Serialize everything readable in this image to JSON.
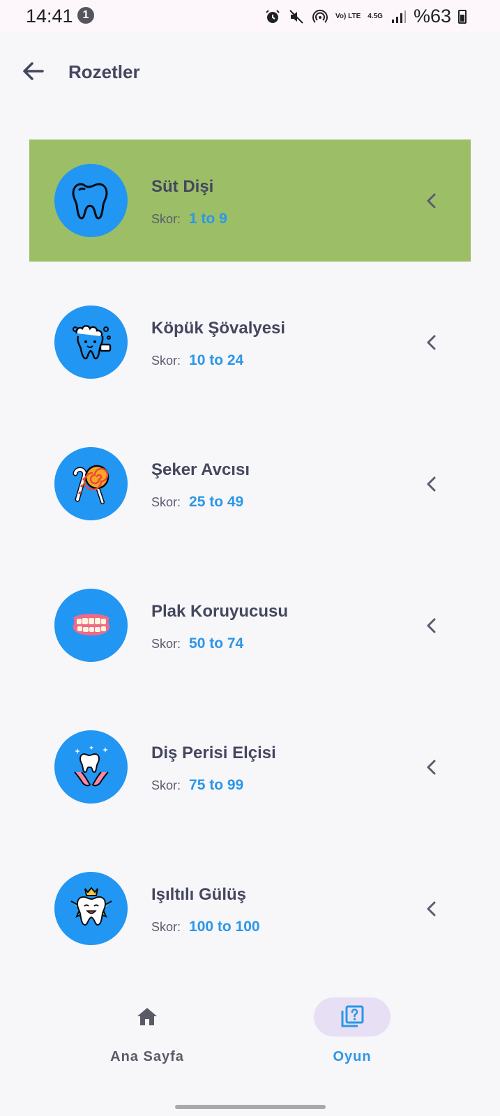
{
  "status_bar": {
    "time": "14:41",
    "notification_count": "1",
    "net_top": "Vo) LTE",
    "net_speed": "4.5G",
    "battery": "%63"
  },
  "appbar": {
    "title": "Rozetler"
  },
  "badges": [
    {
      "name": "Süt Dişi",
      "score_label": "Skor:",
      "score": "1 to 9",
      "selected": true,
      "icon": "tooth-icon"
    },
    {
      "name": "Köpük Şövalyesi",
      "score_label": "Skor:",
      "score": "10 to 24",
      "selected": false,
      "icon": "foam-tooth-icon"
    },
    {
      "name": "Şeker Avcısı",
      "score_label": "Skor:",
      "score": "25 to 49",
      "selected": false,
      "icon": "candy-icon"
    },
    {
      "name": "Plak Koruyucusu",
      "score_label": "Skor:",
      "score": "50 to 74",
      "selected": false,
      "icon": "teeth-icon"
    },
    {
      "name": "Diş Perisi Elçisi",
      "score_label": "Skor:",
      "score": "75 to 99",
      "selected": false,
      "icon": "fairy-tooth-icon"
    },
    {
      "name": "Işıltılı Gülüş",
      "score_label": "Skor:",
      "score": "100 to 100",
      "selected": false,
      "icon": "crowned-tooth-icon"
    }
  ],
  "bottom_nav": {
    "home_label": "Ana Sayfa",
    "game_label": "Oyun",
    "active": "game"
  },
  "colors": {
    "selected_row": "#9bbe66",
    "badge_circle": "#2196f3",
    "score_value": "#2a97e8",
    "nav_active_pill": "#e7dff4"
  }
}
